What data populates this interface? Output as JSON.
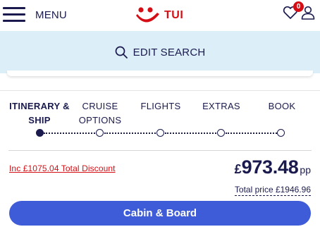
{
  "header": {
    "menu_label": "MENU",
    "logo_text": "TUI",
    "wishlist_count": "0",
    "brand_color": "#d40e14",
    "icons": [
      "hamburger-icon",
      "tui-smile-logo",
      "heart-icon",
      "user-icon"
    ]
  },
  "search": {
    "label": "EDIT SEARCH",
    "icon": "search-icon",
    "background": "#dceef8"
  },
  "steps": [
    {
      "label_line1": "ITINERARY &",
      "label_line2": "SHIP",
      "active": true
    },
    {
      "label_line1": "CRUISE",
      "label_line2": "OPTIONS",
      "active": false
    },
    {
      "label_line1": "FLIGHTS",
      "label_line2": "",
      "active": false
    },
    {
      "label_line1": "EXTRAS",
      "label_line2": "",
      "active": false
    },
    {
      "label_line1": "BOOK",
      "label_line2": "",
      "active": false
    }
  ],
  "pricing": {
    "discount_text": "Inc £1075.04 Total Discount",
    "currency_symbol": "£",
    "price_per_person": "973.48",
    "pp_suffix": "pp",
    "total_text": "Total price £1946.96"
  },
  "cta": {
    "label": "Cabin & Board",
    "color": "#3e5bd8"
  }
}
